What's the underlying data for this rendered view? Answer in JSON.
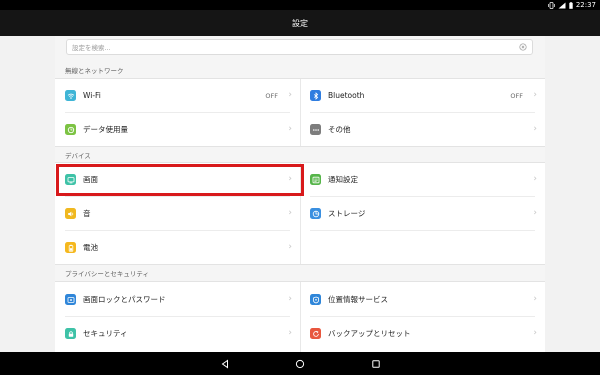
{
  "status_bar": {
    "time": "22:37",
    "icons": [
      "vibrate-icon",
      "signal-icon",
      "battery-icon"
    ]
  },
  "header": {
    "title": "設定"
  },
  "search": {
    "placeholder": "設定を検索..."
  },
  "sections": {
    "network": {
      "title": "無線とネットワーク",
      "items": [
        {
          "label": "Wi-Fi",
          "value": "OFF",
          "icon": "wifi-icon",
          "color": "#3fb5d6"
        },
        {
          "label": "Bluetooth",
          "value": "OFF",
          "icon": "bluetooth-icon",
          "color": "#2f7de0"
        },
        {
          "label": "データ使用量",
          "icon": "data-usage-icon",
          "color": "#7cc343"
        },
        {
          "label": "その他",
          "icon": "more-icon",
          "color": "#7d7d7d"
        }
      ]
    },
    "device": {
      "title": "デバイス",
      "items": [
        {
          "label": "画面",
          "icon": "display-icon",
          "color": "#3ec2a7"
        },
        {
          "label": "通知設定",
          "icon": "notification-icon",
          "color": "#56b54a"
        },
        {
          "label": "音",
          "icon": "sound-icon",
          "color": "#f0b820"
        },
        {
          "label": "ストレージ",
          "icon": "storage-icon",
          "color": "#3a8fe0"
        },
        {
          "label": "電池",
          "icon": "battery-icon",
          "color": "#f5b81e"
        }
      ]
    },
    "privacy": {
      "title": "プライバシーとセキュリティ",
      "items": [
        {
          "label": "画面ロックとパスワード",
          "icon": "lock-icon",
          "color": "#2f86d9"
        },
        {
          "label": "位置情報サービス",
          "icon": "location-icon",
          "color": "#2f86d9"
        },
        {
          "label": "セキュリティ",
          "icon": "security-icon",
          "color": "#3ec2a7"
        },
        {
          "label": "バックアップとリセット",
          "icon": "backup-icon",
          "color": "#e8563e"
        }
      ]
    }
  },
  "highlight": {
    "target": "画面",
    "color": "#d8191b"
  },
  "navigation": {
    "buttons": [
      "back-icon",
      "home-icon",
      "recents-icon"
    ]
  }
}
